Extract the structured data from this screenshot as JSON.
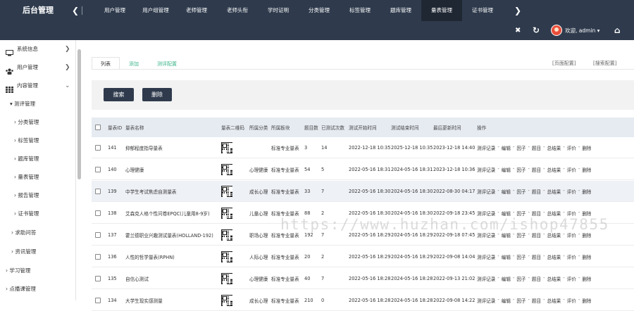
{
  "app": {
    "title": "后台管理"
  },
  "topnav": {
    "items": [
      {
        "label": "用户管理",
        "active": false
      },
      {
        "label": "用户组管理",
        "active": false
      },
      {
        "label": "老师管理",
        "active": false
      },
      {
        "label": "老师头衔",
        "active": false
      },
      {
        "label": "学时证明",
        "active": false
      },
      {
        "label": "分类管理",
        "active": false
      },
      {
        "label": "标签管理",
        "active": false
      },
      {
        "label": "题库管理",
        "active": false
      },
      {
        "label": "量表管理",
        "active": true
      },
      {
        "label": "证书管理",
        "active": false
      }
    ],
    "prev_glyph": "❮",
    "next_glyph": "❯"
  },
  "header": {
    "close_glyph": "✖",
    "refresh_glyph": "↻",
    "welcome": "欢迎, admin ▾",
    "home_glyph": "⌂",
    "accent_avatar": "#e94f3b"
  },
  "sidebar": {
    "items": [
      {
        "label": "系统信息",
        "icon": "monitor-icon",
        "chev": "❯",
        "level": 0
      },
      {
        "label": "用户管理",
        "icon": "users-icon",
        "chev": "❯",
        "level": 0
      },
      {
        "label": "内容管理",
        "icon": "grid-icon",
        "chev": "⌄",
        "level": 0
      },
      {
        "label": "▾ 测评管理",
        "level": 1
      },
      {
        "label": "› 分类管理",
        "level": 2
      },
      {
        "label": "› 标签管理",
        "level": 2
      },
      {
        "label": "› 题库管理",
        "level": 2
      },
      {
        "label": "› 量表管理",
        "level": 2
      },
      {
        "label": "› 报告管理",
        "level": 2
      },
      {
        "label": "› 证书管理",
        "level": 2
      },
      {
        "label": "› 求助问答",
        "level": 1
      },
      {
        "label": "› 资讯管理",
        "level": 1
      },
      {
        "label": "› 学习管理",
        "level": 0.5
      },
      {
        "label": "› 点播课管理",
        "level": 0.5
      }
    ]
  },
  "tabs": [
    {
      "label": "列表",
      "active": true
    },
    {
      "label": "添加",
      "active": false
    },
    {
      "label": "测评配置",
      "active": false
    }
  ],
  "config_links": {
    "page": "[页面配置]",
    "search": "[搜索配置]"
  },
  "buttons": {
    "search": "搜索",
    "delete": "删除"
  },
  "table": {
    "headers": [
      "量表ID",
      "量表名称",
      "量表二维码",
      "所属分类",
      "所属板块",
      "题目数",
      "已测试次数",
      "测试开始时间",
      "测试结束时间",
      "最后更新时间",
      "操作"
    ],
    "op_labels": [
      "测评记录",
      "编辑",
      "因子",
      "题目",
      "总结果",
      "评价",
      "删除"
    ],
    "op_sep": "-",
    "rows": [
      {
        "id": "141",
        "name": "抑郁程度指导量表",
        "category": "",
        "section": "标准专业量表",
        "questions": "3",
        "tested": "14",
        "start": "2022-12-18 10:35",
        "end": "2025-12-18 10:35",
        "updated": "2023-12-18 14:40",
        "highlight": false
      },
      {
        "id": "140",
        "name": "心理健康",
        "category": "心理健康",
        "section": "标准专业量表",
        "questions": "54",
        "tested": "5",
        "start": "2022-05-16 18:31",
        "end": "2024-05-16 18:31",
        "updated": "2023-12-18 10:36",
        "highlight": false
      },
      {
        "id": "139",
        "name": "中学生考试焦虑自测量表",
        "category": "成长心理",
        "section": "标准专业量表",
        "questions": "33",
        "tested": "7",
        "start": "2022-05-16 18:30",
        "end": "2024-05-16 18:30",
        "updated": "2022-08-30 04:17",
        "highlight": true
      },
      {
        "id": "138",
        "name": "艾森克人格个性问卷EPQC(儿童用8-9岁)",
        "category": "儿童心理",
        "section": "标准专业量表",
        "questions": "88",
        "tested": "2",
        "start": "2022-05-16 18:30",
        "end": "2024-05-16 18:30",
        "updated": "2022-09-18 23:45",
        "highlight": false
      },
      {
        "id": "137",
        "name": "霍兰德职业兴趣测试量表(HOLLAND-192)",
        "category": "职场心理",
        "section": "标准专业量表",
        "questions": "192",
        "tested": "7",
        "start": "2022-05-16 18:29",
        "end": "2024-05-16 18:29",
        "updated": "2022-09-18 07:45",
        "highlight": false
      },
      {
        "id": "136",
        "name": "人性的哲学量表(RPHN)",
        "category": "人际心理",
        "section": "标准专业量表",
        "questions": "20",
        "tested": "2",
        "start": "2022-05-16 18:29",
        "end": "2024-05-16 18:29",
        "updated": "2022-09-08 14:04",
        "highlight": false
      },
      {
        "id": "135",
        "name": "自信心测试",
        "category": "心理健康",
        "section": "标准专业量表",
        "questions": "40",
        "tested": "7",
        "start": "2022-05-16 18:28",
        "end": "2024-05-16 18:28",
        "updated": "2022-09-13 21:02",
        "highlight": false
      },
      {
        "id": "134",
        "name": "大学生现实感测量",
        "category": "成长心理",
        "section": "标准专业量表",
        "questions": "210",
        "tested": "0",
        "start": "2022-05-16 18:28",
        "end": "2024-05-16 18:28",
        "updated": "2022-09-08 14:22",
        "highlight": false
      }
    ]
  },
  "watermark": "https://www.huzhan.com/ishop47855"
}
